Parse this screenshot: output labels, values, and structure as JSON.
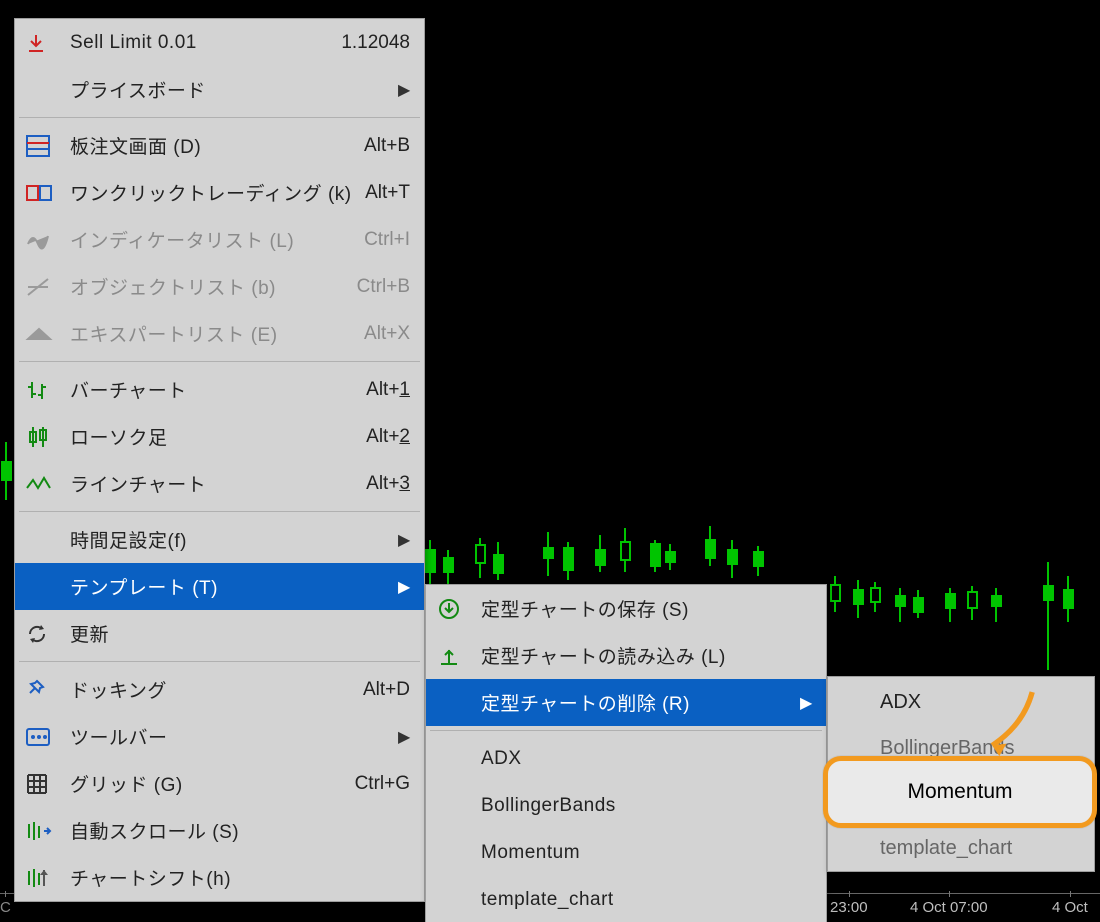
{
  "menu": {
    "sell_limit": {
      "label": "Sell Limit 0.01",
      "value": "1.12048"
    },
    "price_board": {
      "label": "プライスボード"
    },
    "depth": {
      "label": "板注文画面 (D)",
      "shortcut": "Alt+B"
    },
    "oneclick": {
      "label": "ワンクリックトレーディング (k)",
      "shortcut": "Alt+T"
    },
    "indlist": {
      "label": "インディケータリスト (L)",
      "shortcut": "Ctrl+I"
    },
    "objlist": {
      "label": "オブジェクトリスト (b)",
      "shortcut": "Ctrl+B"
    },
    "explist": {
      "label": "エキスパートリスト (E)",
      "shortcut": "Alt+X"
    },
    "barchart": {
      "label": "バーチャート",
      "shortcut_plain": "Alt+",
      "shortcut_ul": "1"
    },
    "candle": {
      "label": "ローソク足",
      "shortcut_plain": "Alt+",
      "shortcut_ul": "2"
    },
    "linechart": {
      "label": "ラインチャート",
      "shortcut_plain": "Alt+",
      "shortcut_ul": "3"
    },
    "timeframe": {
      "label": "時間足設定(f)"
    },
    "template": {
      "label": "テンプレート (T)"
    },
    "refresh": {
      "label": "更新"
    },
    "docking": {
      "label": "ドッキング",
      "shortcut": "Alt+D"
    },
    "toolbar": {
      "label": "ツールバー"
    },
    "grid": {
      "label": "グリッド (G)",
      "shortcut": "Ctrl+G"
    },
    "autoscroll": {
      "label": "自動スクロール (S)"
    },
    "chartshift": {
      "label": "チャートシフト(h)"
    }
  },
  "submenu": {
    "save": {
      "label": "定型チャートの保存 (S)"
    },
    "load": {
      "label": "定型チャートの読み込み (L)"
    },
    "delete": {
      "label": "定型チャートの削除 (R)"
    },
    "items": [
      "ADX",
      "BollingerBands",
      "Momentum",
      "template_chart"
    ]
  },
  "deletemenu": {
    "items": [
      "ADX",
      "BollingerBands",
      "template_chart"
    ],
    "highlighted": "Momentum"
  },
  "xaxis": [
    "23:00",
    "4 Oct 07:00",
    "4 Oct"
  ]
}
